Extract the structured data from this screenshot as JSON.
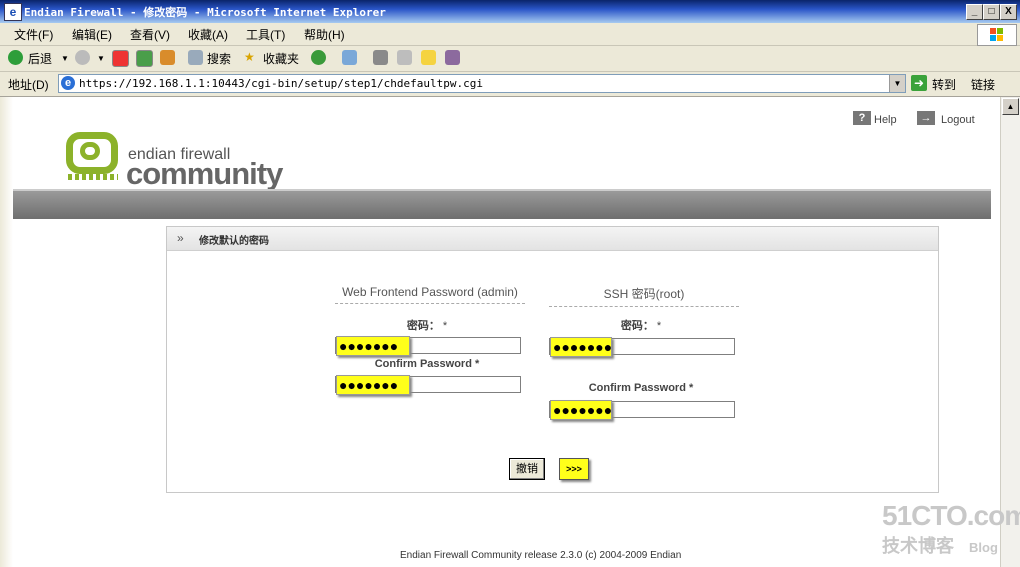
{
  "window": {
    "title": "Endian Firewall - 修改密码 - Microsoft Internet Explorer",
    "controls": [
      "_",
      "□",
      "X"
    ]
  },
  "menubar": {
    "items": [
      "文件(F)",
      "编辑(E)",
      "查看(V)",
      "收藏(A)",
      "工具(T)",
      "帮助(H)"
    ]
  },
  "toolbar": {
    "back_label": "后退",
    "search_label": "搜索",
    "favorites_label": "收藏夹"
  },
  "addressbar": {
    "label": "地址(D)",
    "url": "https://192.168.1.1:10443/cgi-bin/setup/step1/chdefaultpw.cgi",
    "go_label": "转到",
    "links_label": "链接"
  },
  "page": {
    "help_label": "Help",
    "logout_label": "Logout",
    "logo": {
      "line1": "endian firewall",
      "line2": "community"
    },
    "panel": {
      "title": "修改默认的密码",
      "arrow": "»",
      "web_section": {
        "heading": "Web Frontend Password (admin)",
        "password_label": "密码：",
        "required_mark": "*",
        "password_value": "●●●●●●●",
        "confirm_label": "Confirm Password *",
        "confirm_value": "●●●●●●●"
      },
      "ssh_section": {
        "heading": "SSH 密码(root)",
        "password_label": "密码：",
        "required_mark": "*",
        "password_value": "●●●●●●●",
        "confirm_label": "Confirm Password *",
        "confirm_value": "●●●●●●●"
      },
      "cancel_label": "撤销",
      "next_label": ">>>"
    },
    "footer": "Endian Firewall Community release 2.3.0 (c) 2004-2009 Endian"
  },
  "watermark": {
    "line1": "51CTO.com",
    "line2": "技术博客",
    "line3": "Blog"
  },
  "colors": {
    "highlight": "#ffff1a",
    "brand_green": "#8cb22a",
    "band_gray": "#7a7a7a"
  }
}
